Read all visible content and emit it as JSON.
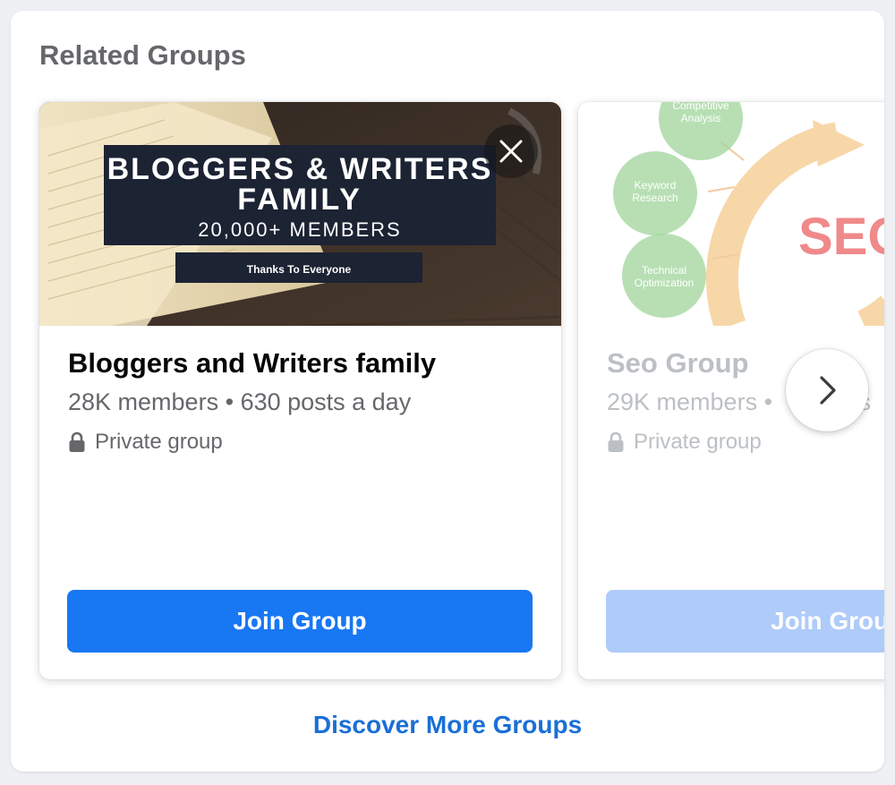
{
  "panel": {
    "title": "Related Groups"
  },
  "groups": [
    {
      "name": "Bloggers and Writers family",
      "members": "28K members",
      "separator": "•",
      "activity": "630 posts a day",
      "privacy": "Private group",
      "join_label": "Join Group",
      "cover": {
        "line1": "BLOGGERS & WRITERS",
        "line2": "FAMILY",
        "line3": "20,000+ MEMBERS",
        "line4": "Thanks To Everyone"
      }
    },
    {
      "name": "Seo Group",
      "members": "29K members",
      "separator": "•",
      "activity": "os",
      "privacy": "Private group",
      "join_label": "Join Grou",
      "cover": {
        "bubble1": "Competitive Analysis",
        "bubble1_a": "Competitive",
        "bubble1_b": "Analysis",
        "bubble2_a": "Keyword",
        "bubble2_b": "Research",
        "bubble3_a": "Technical",
        "bubble3_b": "Optimization",
        "headline": "SEO"
      }
    }
  ],
  "footer": {
    "discover_label": "Discover More Groups"
  },
  "icons": {
    "close": "close-icon",
    "next": "chevron-right-icon",
    "lock": "lock-icon"
  },
  "colors": {
    "accent": "#1877f2",
    "link": "#1a6fd6",
    "muted": "#65676b"
  }
}
